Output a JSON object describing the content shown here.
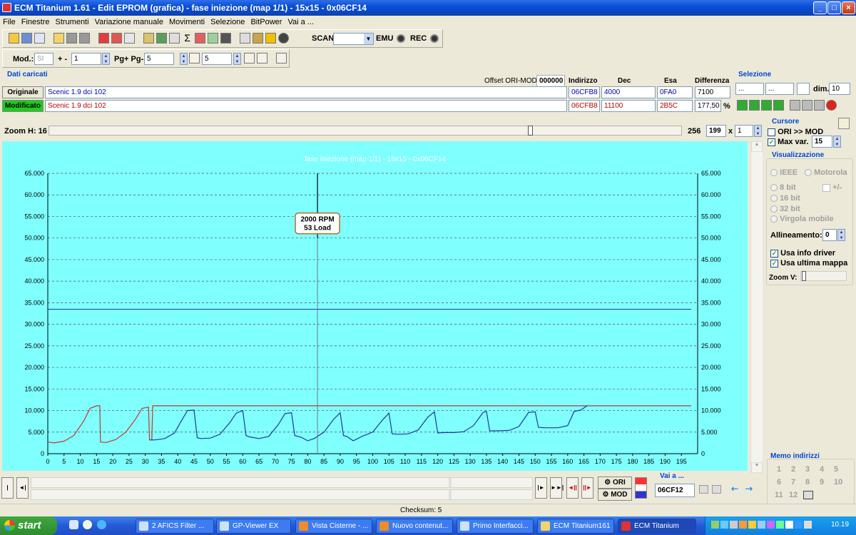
{
  "window": {
    "title": "ECM Titanium 1.61 - Edit EPROM (grafica) - fase iniezione (map 1/1) - 15x15 - 0x06CF14",
    "controls": {
      "min": "_",
      "max": "□",
      "close": "×"
    }
  },
  "menu": [
    "File",
    "Finestre",
    "Strumenti",
    "Variazione manuale",
    "Movimenti",
    "Selezione",
    "BitPower",
    "Vai a ..."
  ],
  "toolbar1": {
    "scan_label": "SCAN",
    "emu_label": "EMU",
    "rec_label": "REC",
    "icons": [
      "home-icon",
      "copy-icon",
      "window-icon",
      "open-icon",
      "save-icon",
      "disk-icon",
      "check-icon",
      "undo-icon",
      "grid-icon",
      "print-icon",
      "calculator-icon",
      "edit-icon",
      "sigma-icon",
      "chart-icon",
      "map-icon",
      "binoculars-icon",
      "terminal-icon",
      "lock-icon",
      "run-icon",
      "circle-icon"
    ]
  },
  "toolbar2": {
    "mod_label": "Mod.:",
    "mod_value": "SI",
    "pm_label": "+ -",
    "pm_value": "1",
    "pg_label": "Pg+ Pg-",
    "pg_value": "5",
    "step_value": "5"
  },
  "dati": {
    "title": "Dati caricati",
    "offset_label": "Offset ORI-MOD",
    "offset_value": "000000",
    "headers": {
      "indirizzo": "Indirizzo",
      "dec": "Dec",
      "esa": "Esa",
      "differenza": "Differenza"
    },
    "originale": {
      "label": "Originale",
      "name": "Scenic 1.9 dci 102",
      "indirizzo": "06CFB8",
      "dec": "4000",
      "esa": "0FA0",
      "diff": "7100"
    },
    "modificato": {
      "label": "Modificato",
      "name": "Scenic 1.9 dci 102",
      "indirizzo": "06CFB8",
      "dec": "11100",
      "esa": "2B5C",
      "diff": "177,50",
      "unit": "%"
    }
  },
  "selezione": {
    "title": "Selezione",
    "field1": "...",
    "field2": "...",
    "dim_label": "dim.",
    "dim_value": "10"
  },
  "zoom": {
    "label": "Zoom H: 16",
    "max": "256",
    "value": "199",
    "x": "x",
    "mult": "1"
  },
  "cursore": {
    "title": "Cursore",
    "ori_mod": "ORI >> MOD",
    "max_var_label": "Max var.",
    "max_var_value": "15"
  },
  "visualizzazione": {
    "title": "Visualizzazione",
    "ieee": "IEEE",
    "motorola": "Motorola",
    "bit8": "8 bit",
    "plusminus": "+/-",
    "bit16": "16 bit",
    "bit32": "32 bit",
    "virgola": "Virgola mobile",
    "allineamento_label": "Allineamento:",
    "allineamento_value": "0",
    "usa_info": "Usa info driver",
    "usa_ultima": "Usa ultima mappa",
    "zoom_v": "Zoom V:"
  },
  "memo": {
    "title": "Memo indirizzi",
    "items": [
      "1",
      "2",
      "3",
      "4",
      "5",
      "6",
      "7",
      "8",
      "9",
      "10",
      "11",
      "12"
    ]
  },
  "bottom": {
    "ori": "ORI",
    "mod": "MOD",
    "vai_label": "Vai a ...",
    "vai_value": "06CF12",
    "checksum": "Checksum: 5"
  },
  "chart_data": {
    "type": "line",
    "title": "fase iniezione (map 1/1) - 15x15 - 0x06CF14",
    "xlim": [
      0,
      200
    ],
    "ylim": [
      0,
      65000
    ],
    "x_ticks": [
      0,
      5,
      10,
      15,
      20,
      25,
      30,
      35,
      40,
      45,
      50,
      55,
      60,
      65,
      70,
      75,
      80,
      85,
      90,
      95,
      100,
      105,
      110,
      115,
      120,
      125,
      130,
      135,
      140,
      145,
      150,
      155,
      160,
      165,
      170,
      175,
      180,
      185,
      190,
      195
    ],
    "y_ticks": [
      "0",
      "5.000",
      "10.000",
      "15.000",
      "20.000",
      "25.000",
      "30.000",
      "35.000",
      "40.000",
      "45.000",
      "50.000",
      "55.000",
      "60.000",
      "65.000"
    ],
    "y_tick_values": [
      0,
      5000,
      10000,
      15000,
      20000,
      25000,
      30000,
      35000,
      40000,
      45000,
      50000,
      55000,
      60000,
      65000
    ],
    "cursor": {
      "x": 83,
      "label1": "2000 RPM",
      "label2": "53 Load"
    },
    "hline": 33500,
    "series": [
      {
        "color": "#c0392b",
        "points": [
          [
            0,
            2700
          ],
          [
            2,
            2500
          ],
          [
            5,
            2900
          ],
          [
            8,
            4200
          ],
          [
            11,
            7500
          ],
          [
            13,
            10500
          ],
          [
            15,
            11100
          ],
          [
            16,
            11100
          ],
          [
            16.2,
            2700
          ],
          [
            18,
            2600
          ],
          [
            21,
            3300
          ],
          [
            24,
            5000
          ],
          [
            27,
            8000
          ],
          [
            29,
            10500
          ],
          [
            31,
            10800
          ],
          [
            31.3,
            3200
          ],
          [
            32,
            3200
          ],
          [
            32.3,
            11100
          ],
          [
            198,
            11100
          ]
        ]
      },
      {
        "color": "#1f3aa0",
        "points": [
          [
            31.3,
            3200
          ],
          [
            33,
            3200
          ],
          [
            36,
            3500
          ],
          [
            39,
            4800
          ],
          [
            41,
            7500
          ],
          [
            43,
            10000
          ],
          [
            45,
            10100
          ],
          [
            46,
            3700
          ],
          [
            47,
            3500
          ],
          [
            50,
            3600
          ],
          [
            53,
            4500
          ],
          [
            56,
            7200
          ],
          [
            58,
            9400
          ],
          [
            60,
            10000
          ],
          [
            61,
            4200
          ],
          [
            62,
            3900
          ],
          [
            65,
            3500
          ],
          [
            68,
            4000
          ],
          [
            71,
            6800
          ],
          [
            73,
            9300
          ],
          [
            75,
            9500
          ],
          [
            76,
            4200
          ],
          [
            78,
            3800
          ],
          [
            80,
            3000
          ],
          [
            82,
            3500
          ],
          [
            85,
            5000
          ],
          [
            88,
            8000
          ],
          [
            90,
            9500
          ],
          [
            91,
            4200
          ],
          [
            92,
            4000
          ],
          [
            94,
            3000
          ],
          [
            97,
            4100
          ],
          [
            100,
            5000
          ],
          [
            103,
            7800
          ],
          [
            105,
            9400
          ],
          [
            106,
            4600
          ],
          [
            108,
            4500
          ],
          [
            111,
            4600
          ],
          [
            114,
            5500
          ],
          [
            117,
            8500
          ],
          [
            119,
            9700
          ],
          [
            120,
            4800
          ],
          [
            122,
            4900
          ],
          [
            125,
            4900
          ],
          [
            128,
            5100
          ],
          [
            131,
            6500
          ],
          [
            134,
            9600
          ],
          [
            135,
            9800
          ],
          [
            136,
            5300
          ],
          [
            138,
            5300
          ],
          [
            142,
            5400
          ],
          [
            145,
            6300
          ],
          [
            148,
            9600
          ],
          [
            150,
            9700
          ],
          [
            151,
            6100
          ],
          [
            153,
            6000
          ],
          [
            157,
            6000
          ],
          [
            160,
            6500
          ],
          [
            162,
            9800
          ],
          [
            164,
            10100
          ],
          [
            166,
            11100
          ]
        ]
      }
    ]
  },
  "taskbar": {
    "start": "start",
    "tasks": [
      "2 AFICS Filter ...",
      "GP-Viewer EX",
      "Vista Cisterne - ...",
      "Nuovo contenut...",
      "Primo Interfacci...",
      "ECM Titanium161",
      "ECM Titanium"
    ],
    "time": "10.19"
  }
}
